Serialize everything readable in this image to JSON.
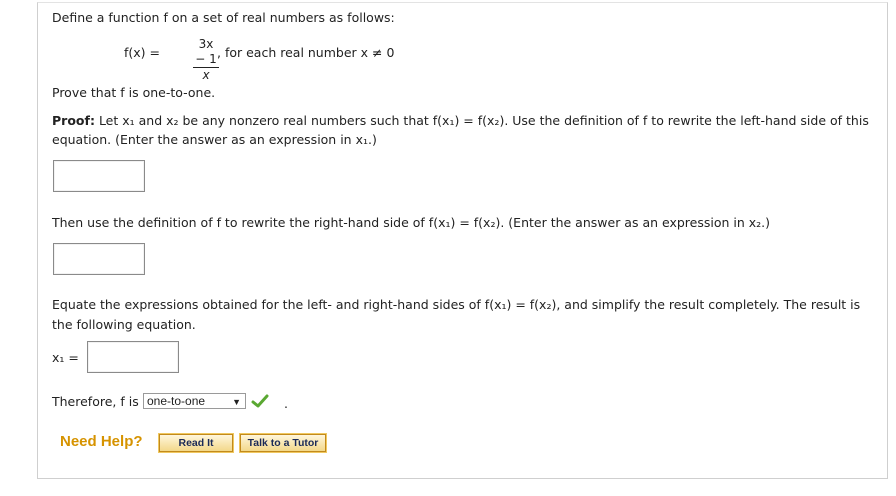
{
  "intro": "Define a function f on a set of real numbers as follows:",
  "formula": {
    "lhs": "f(x) =",
    "numerator": "3x − 1",
    "denominator": "x",
    "condition": ", for each real number x ≠ 0"
  },
  "prove": "Prove that f is one-to-one.",
  "proof": {
    "label": "Proof:",
    "line1": "Let x₁ and x₂ be any nonzero real numbers such that f(x₁) = f(x₂). Use the definition of f to rewrite the left-hand side of this",
    "line2": "equation. (Enter the answer as an expression in x₁.)"
  },
  "step2": "Then use the definition of f to rewrite the right-hand side of f(x₁) = f(x₂). (Enter the answer as an expression in x₂.)",
  "step3": {
    "line1": "Equate the expressions obtained for the left- and right-hand sides of f(x₁) = f(x₂), and simplify the result completely. The result is",
    "line2": "the following equation."
  },
  "answer_lhs": "x₁ =",
  "answers": {
    "box1": "",
    "box2": "",
    "box3": ""
  },
  "therefore": {
    "prefix": "Therefore, f is",
    "selected": "one-to-one",
    "suffix": "."
  },
  "help": {
    "label": "Need Help?",
    "read_it": "Read It",
    "talk_tutor": "Talk to a Tutor"
  },
  "colors": {
    "help": "#d69300",
    "check": "#5aa832",
    "button_border": "#c28a1c"
  }
}
